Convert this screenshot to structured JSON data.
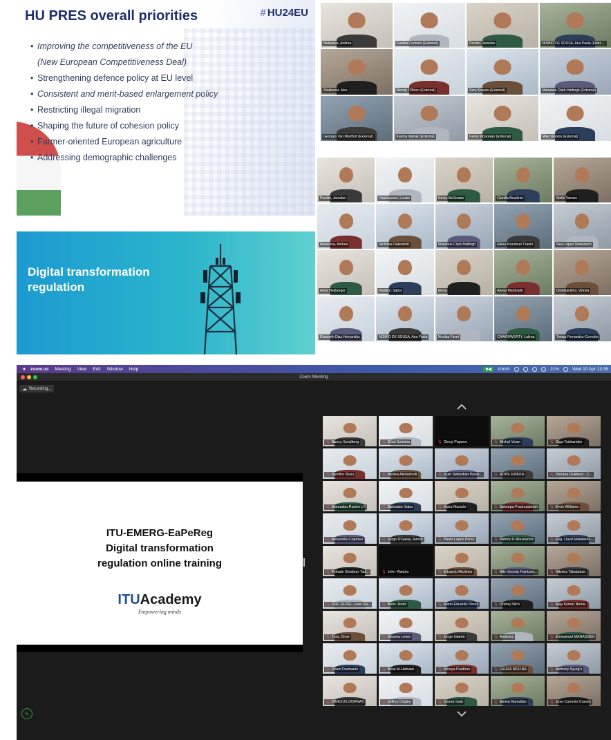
{
  "slide1": {
    "title": "HU PRES overall priorities",
    "logo": "HU24EU",
    "bullets": [
      "Improving the competitiveness of the EU",
      "(New European Competitiveness Deal)",
      "Strengthening defence policy at EU level",
      "Consistent and merit-based enlargement policy",
      "Restricting illegal migration",
      "Shaping the future of cohesion policy",
      "Farmer-oriented European agriculture",
      "Addressing demographic challenges"
    ]
  },
  "slide2": {
    "title": "Digital transformation regulation"
  },
  "grid1": {
    "participants": [
      "Matasova, Andrea",
      "Camilla Contorni (External)",
      "Ponder, Jaroslav",
      "NISHIO DE SOUSA, Ana Paula (External)",
      "Shalbuzer, Alex",
      "Wendy O'Brien (External)",
      "Sara Knauss (External)",
      "Marianne Clark-Hattingh (External)",
      "Georges Van Montfort (External)",
      "Karima Mariak (External)",
      "Ivenia McGowan (External)",
      "Mike Watson (External)"
    ]
  },
  "grid2": {
    "participants": [
      "Ponder, Jaroslav",
      "Haarhausen, Louise",
      "Ivenia McGowan",
      "Camilla Bruckner",
      "Stella Tamaro",
      "Matasova, Andrea",
      "Nicholas Oakeshott",
      "Marianne Clark-Hattingh",
      "Elena Kountouri Tzanni",
      "Sara Lopez Domenech",
      "Anna Hedberger",
      "Frederic Sabor",
      "Elena",
      "Anwar Mahfoudh",
      "Omolbanikha, Vittoria",
      "Elisabeth Diaz Hernandez",
      "NISHIO DE SOUSA, Ana Paula",
      "Nicolas Favet",
      "CHAKRAVERTY, Lalena",
      "Tomas Fernandez-Corredor"
    ]
  },
  "zoom": {
    "menubar": {
      "app": "zoom.us",
      "items": [
        "Meeting",
        "View",
        "Edit",
        "Window",
        "Help"
      ],
      "brand": "zoom",
      "battery": "21%",
      "clock": "Wed 10 Apr 13:35"
    },
    "window_title": "Zoom Meeting",
    "recording": "Recording...",
    "shared": {
      "line1": "ITU-EMERG-EaPeReg",
      "line2": "Digital transformation",
      "line3": "regulation online training",
      "logo_itu": "ITU",
      "logo_rest": "Academy",
      "tagline": "Empowering minds"
    },
    "participants": [
      "Nancy Sundberg",
      "Elind Sulmina",
      "Giorgi Papava",
      "Michal  Vizan",
      "Giga Tsiskaridze",
      "Dumitru Rusu",
      "Medea Akolashvili",
      "Juan Sebastian Perez...",
      "HOPE EWEKA",
      "Doriana Guiducci - C...",
      "Mamadou Racine LY",
      "Bakradze Saba",
      "Vaiva Maciule",
      "Sakonpa Prachuabmoh",
      "Ervin Williams",
      "Alexandru Cojuhari",
      "Jorge D'Garay Juncal",
      "Paulo Lopez Perez",
      "Patrick R Moustache",
      "Eng. Lloyd Matabishi-...",
      "Fekade Getahun Tad...",
      "John Wanjiru",
      "Eduardo Martinez",
      "Niki Victoria Frantzes...",
      "Nikoloz Tabatadze",
      "CRC-SUTEL-Juan Ga...",
      "Boris Jevric",
      "Mario Eduardo Perez",
      "Ondrej Stich",
      "Ajay Kumar Nema",
      "Tunç Ömer",
      "Shanea Lewis",
      "Jorge Infante",
      "Andreisy",
      "Emmanuel MANASSEH",
      "Owen Darmanin",
      "Belal Al-Hafnawi",
      "Shreya Pradhan",
      "LAURA MOLINA",
      "Anthony Njung'e",
      "VINICIUS DORNAS",
      "Jeffrey Dogley",
      "Osman Isak",
      "Amina Ramallan",
      "Jose Carmelo Cuesto"
    ],
    "active_speaker_index": 1
  },
  "colors": {
    "navy": "#1f2f6b",
    "teal": "#2ab4cc",
    "zoom_green": "#2aa34a",
    "mute_red": "#ff4d4d"
  }
}
